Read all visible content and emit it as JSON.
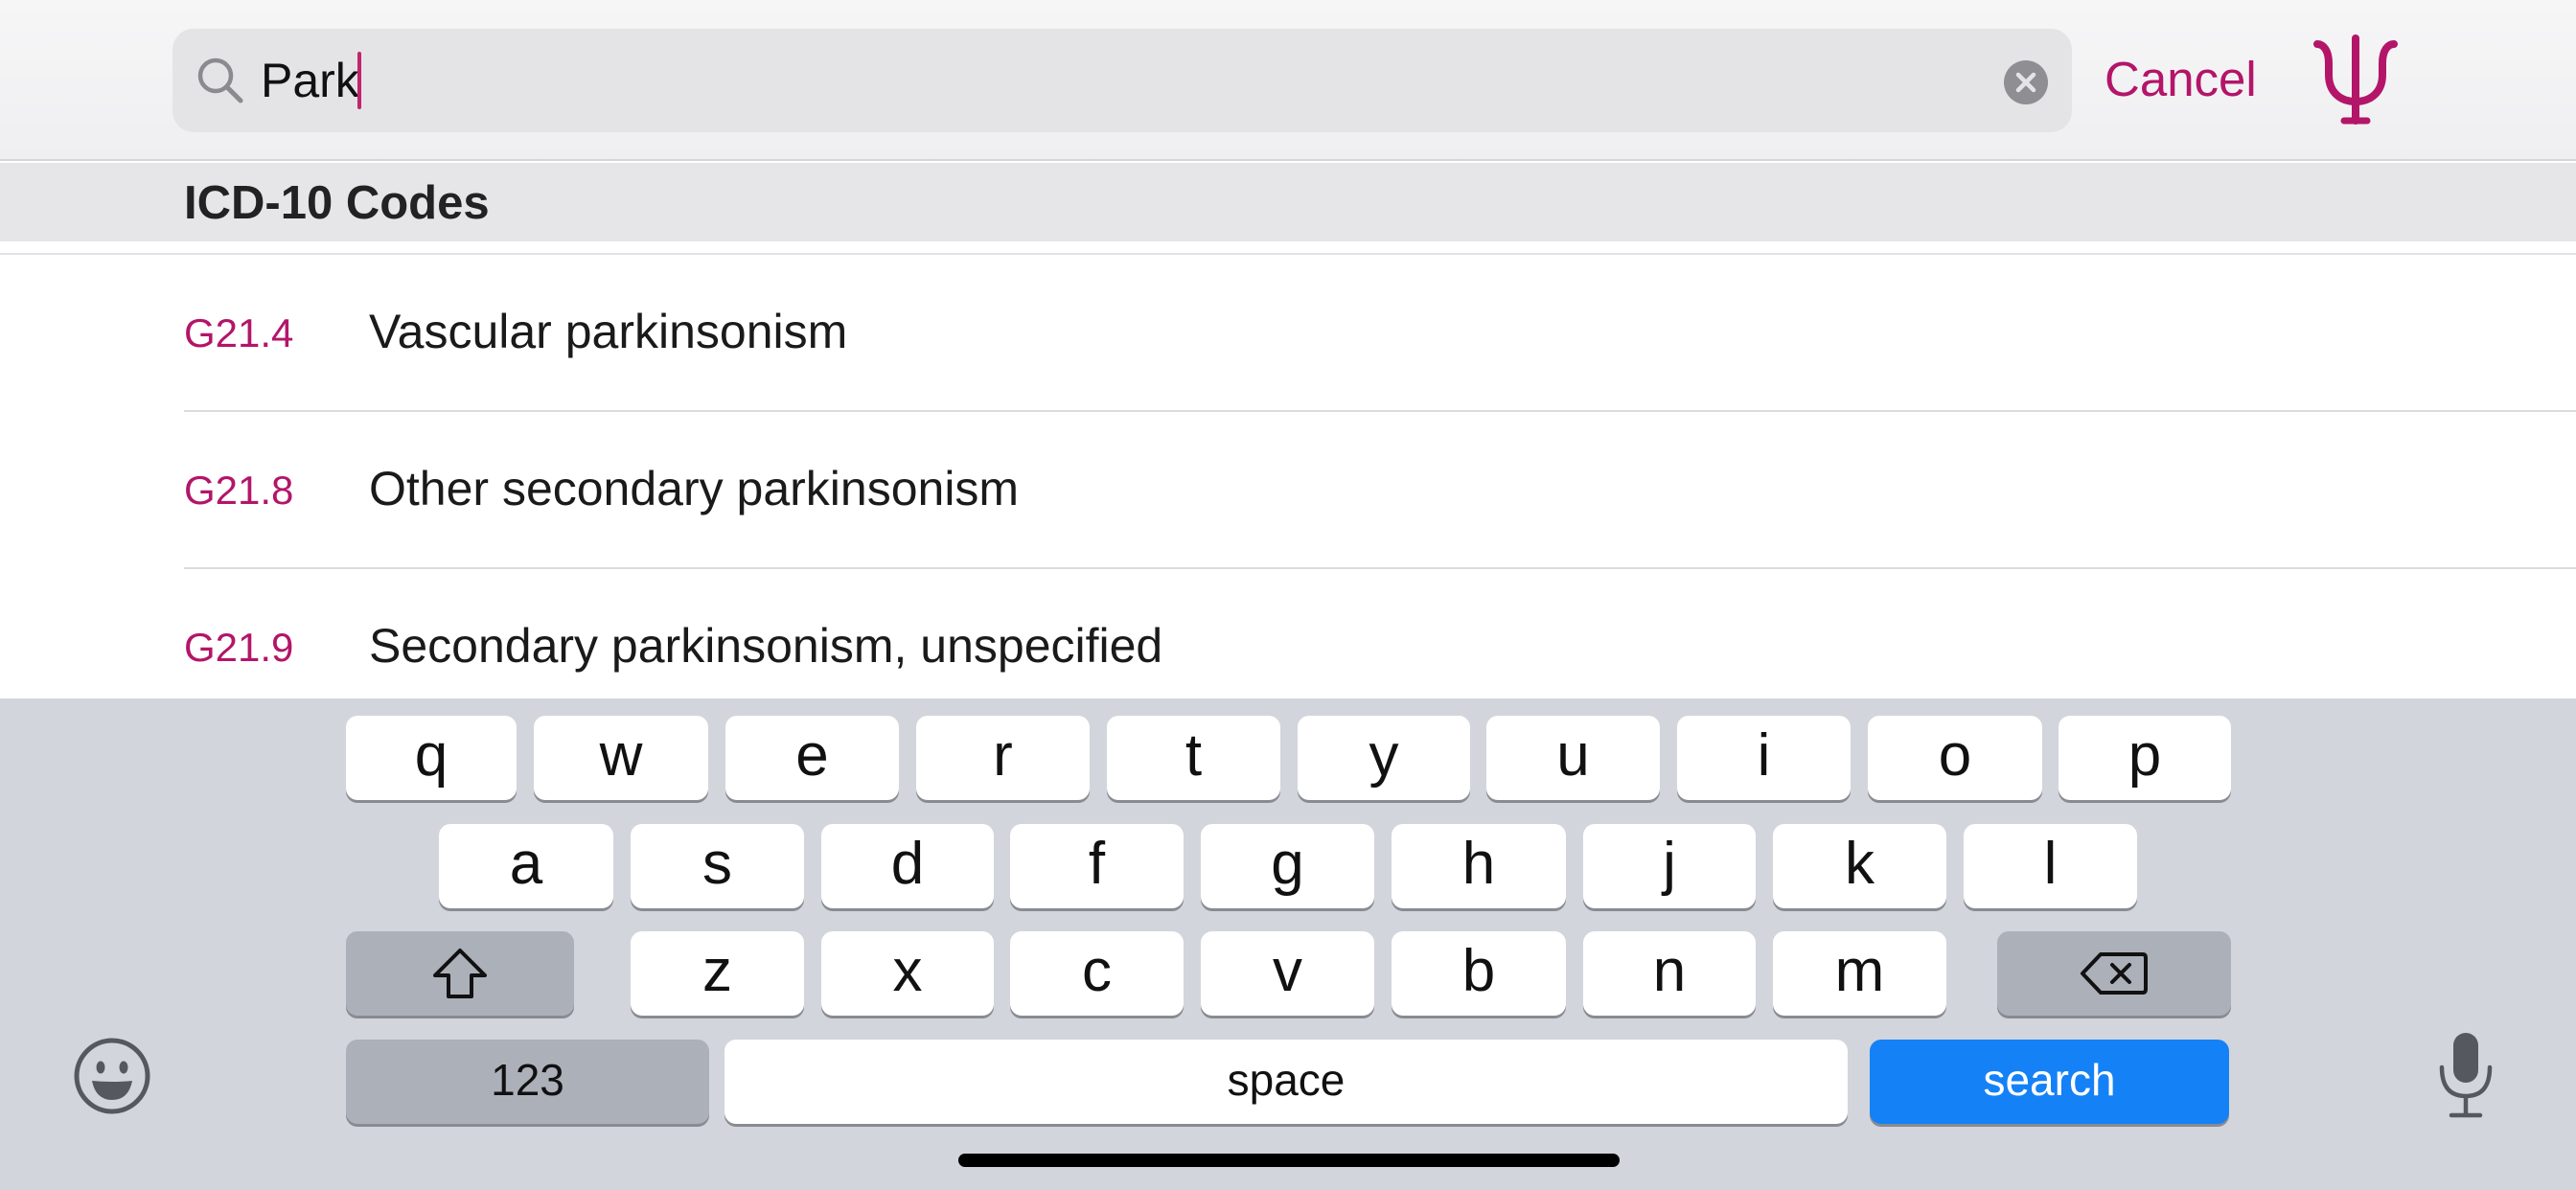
{
  "search": {
    "query": "Park",
    "cancel_label": "Cancel"
  },
  "results": {
    "section_title": "ICD-10 Codes",
    "rows": [
      {
        "code": "G21.4",
        "description": "Vascular parkinsonism"
      },
      {
        "code": "G21.8",
        "description": "Other secondary parkinsonism"
      },
      {
        "code": "G21.9",
        "description": "Secondary parkinsonism, unspecified"
      }
    ]
  },
  "keyboard": {
    "row1": [
      "q",
      "w",
      "e",
      "r",
      "t",
      "y",
      "u",
      "i",
      "o",
      "p"
    ],
    "row2": [
      "a",
      "s",
      "d",
      "f",
      "g",
      "h",
      "j",
      "k",
      "l"
    ],
    "row3": [
      "z",
      "x",
      "c",
      "v",
      "b",
      "n",
      "m"
    ],
    "numbers_label": "123",
    "space_label": "space",
    "search_label": "search"
  },
  "icons": {
    "search": "search-icon",
    "clear": "clear-text-icon",
    "brand": "psi-logo-icon",
    "shift": "shift-icon",
    "delete": "backspace-icon",
    "emoji": "emoji-icon",
    "dictation": "microphone-icon"
  },
  "colors": {
    "accent": "#b31569",
    "search_key": "#1581f6",
    "keyboard_bg": "#d2d5db"
  }
}
